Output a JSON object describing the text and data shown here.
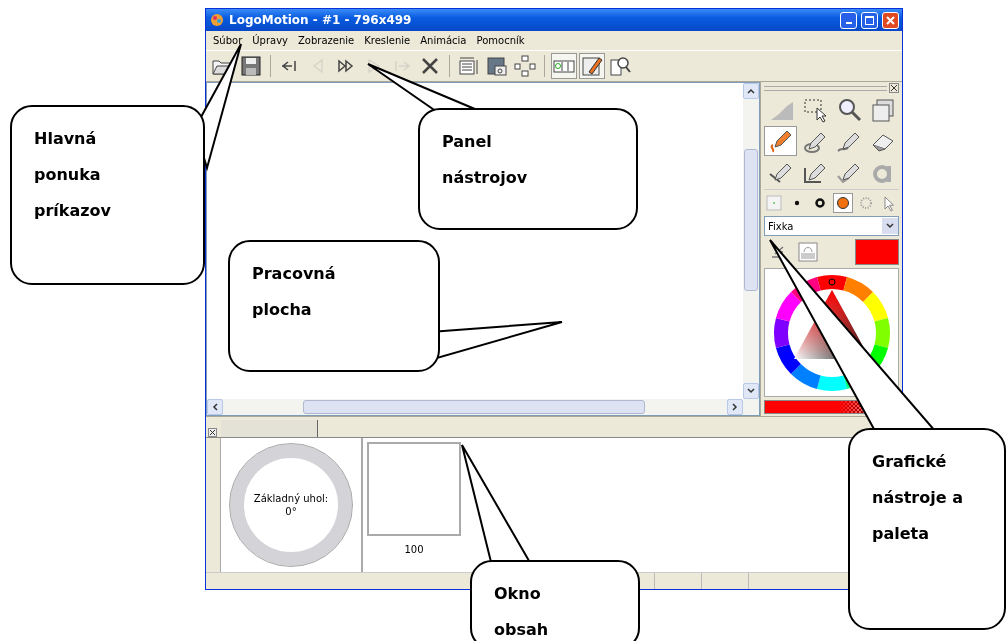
{
  "window": {
    "title": "LogoMotion - #1 - 796x499"
  },
  "menu": [
    "Súbor",
    "Úpravy",
    "Zobrazenie",
    "Kreslenie",
    "Animácia",
    "Pomocník"
  ],
  "toolbar": [
    {
      "kind": "open",
      "selected": false,
      "disabled": false
    },
    {
      "kind": "save",
      "selected": false,
      "disabled": false
    },
    {
      "kind": "sep"
    },
    {
      "kind": "first",
      "selected": false,
      "disabled": false
    },
    {
      "kind": "prev",
      "selected": false,
      "disabled": true
    },
    {
      "kind": "forward",
      "selected": false,
      "disabled": false
    },
    {
      "kind": "play",
      "selected": false,
      "disabled": true
    },
    {
      "kind": "last",
      "selected": false,
      "disabled": true
    },
    {
      "kind": "delete",
      "selected": false,
      "disabled": false
    },
    {
      "kind": "sep"
    },
    {
      "kind": "size",
      "selected": false,
      "disabled": false
    },
    {
      "kind": "image",
      "selected": false,
      "disabled": false
    },
    {
      "kind": "transform",
      "selected": false,
      "disabled": false
    },
    {
      "kind": "sep"
    },
    {
      "kind": "film",
      "selected": true,
      "disabled": false
    },
    {
      "kind": "palette",
      "selected": true,
      "disabled": false
    },
    {
      "kind": "preview",
      "selected": false,
      "disabled": false
    }
  ],
  "tools": [
    {
      "kind": "fill",
      "selected": false
    },
    {
      "kind": "select",
      "selected": false
    },
    {
      "kind": "zoom",
      "selected": false
    },
    {
      "kind": "layers",
      "selected": false
    },
    {
      "kind": "pen",
      "selected": true
    },
    {
      "kind": "pen-circle",
      "selected": false
    },
    {
      "kind": "pen-free",
      "selected": false
    },
    {
      "kind": "eraser",
      "selected": false
    },
    {
      "kind": "pen-line",
      "selected": false
    },
    {
      "kind": "pen-rect",
      "selected": false
    },
    {
      "kind": "pen-check",
      "selected": false
    },
    {
      "kind": "text",
      "selected": false
    }
  ],
  "brushes": [
    {
      "kind": "tiny",
      "selected": false
    },
    {
      "kind": "small",
      "selected": false
    },
    {
      "kind": "ring",
      "selected": false
    },
    {
      "kind": "solid",
      "selected": true
    },
    {
      "kind": "spray",
      "selected": false
    },
    {
      "kind": "pointer",
      "selected": false
    }
  ],
  "brush_type": {
    "value": "Fixka"
  },
  "angle": {
    "label": "Základný uhol:",
    "value": "0°"
  },
  "frames": [
    {
      "caption": "100"
    }
  ],
  "callouts": [
    "Hlavná ponuka príkazov",
    "Panel nástrojov",
    "Pracovná plocha",
    "Grafické nástroje a paleta",
    "Okno obsah"
  ]
}
